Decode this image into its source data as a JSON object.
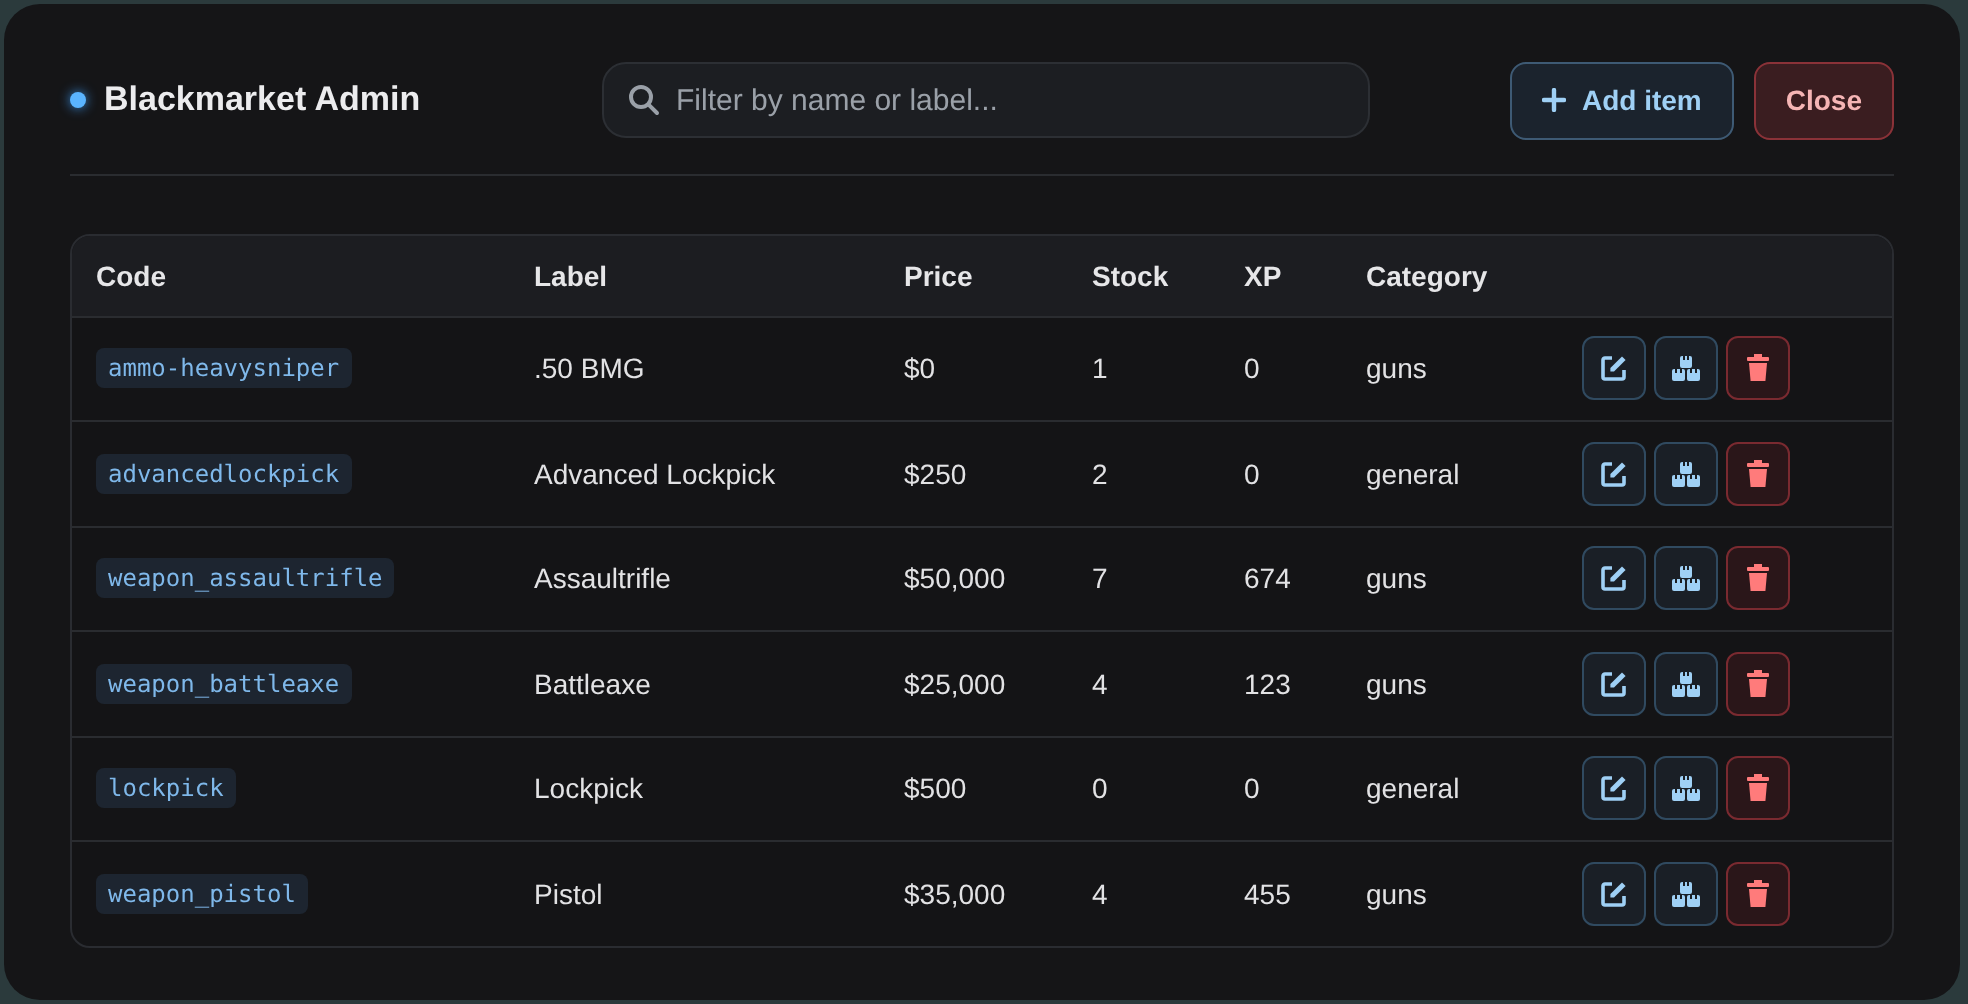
{
  "window": {
    "title": "Blackmarket Admin"
  },
  "search": {
    "placeholder": "Filter by name or label..."
  },
  "buttons": [
    {
      "kind": "add",
      "label": "Add item"
    },
    {
      "kind": "close",
      "label": "Close"
    }
  ],
  "table": {
    "columns": [
      "Code",
      "Label",
      "Price",
      "Stock",
      "XP",
      "Category"
    ],
    "rows": [
      {
        "code": "ammo-heavysniper",
        "label": ".50 BMG",
        "price": "$0",
        "stock": "1",
        "xp": "0",
        "category": "guns"
      },
      {
        "code": "advancedlockpick",
        "label": "Advanced Lockpick",
        "price": "$250",
        "stock": "2",
        "xp": "0",
        "category": "general"
      },
      {
        "code": "weapon_assaultrifle",
        "label": "Assaultrifle",
        "price": "$50,000",
        "stock": "7",
        "xp": "674",
        "category": "guns"
      },
      {
        "code": "weapon_battleaxe",
        "label": "Battleaxe",
        "price": "$25,000",
        "stock": "4",
        "xp": "123",
        "category": "guns"
      },
      {
        "code": "lockpick",
        "label": "Lockpick",
        "price": "$500",
        "stock": "0",
        "xp": "0",
        "category": "general"
      },
      {
        "code": "weapon_pistol",
        "label": "Pistol",
        "price": "$35,000",
        "stock": "4",
        "xp": "455",
        "category": "guns"
      }
    ]
  }
}
